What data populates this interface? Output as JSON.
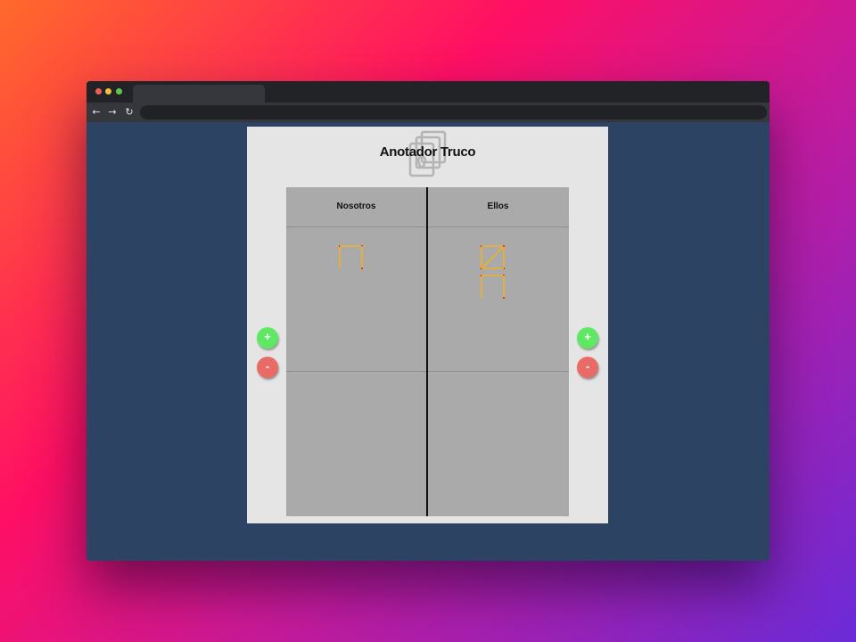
{
  "app": {
    "title": "Anotador Truco"
  },
  "teams": [
    {
      "name": "Nosotros",
      "points": 3,
      "plus_label": "+",
      "minus_label": "-"
    },
    {
      "name": "Ellos",
      "points": 8,
      "plus_label": "+",
      "minus_label": "-"
    }
  ],
  "colors": {
    "match": "#f0b028",
    "match_head": "#e03a10",
    "plus_button": "#5ee864",
    "minus_button": "#ea6a66",
    "board": "#aaaaaa",
    "panel": "#e5e5e5"
  },
  "icons": {
    "back": "arrow-left-icon",
    "forward": "arrow-right-icon",
    "reload": "reload-icon",
    "logo": "cards-logo-icon"
  }
}
